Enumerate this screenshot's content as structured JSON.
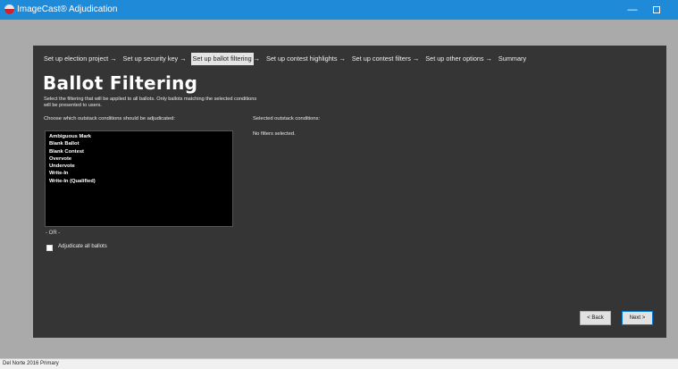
{
  "window": {
    "title": "ImageCast® Adjudication",
    "minimize_glyph": "—",
    "app_icon": "imagecast-logo-icon"
  },
  "wizard": {
    "steps": [
      {
        "label": "Set up election project",
        "active": false
      },
      {
        "label": "Set up security key",
        "active": false
      },
      {
        "label": "Set up ballot filtering",
        "active": true
      },
      {
        "label": "Set up contest highlights",
        "active": false
      },
      {
        "label": "Set up contest filters",
        "active": false
      },
      {
        "label": "Set up other options",
        "active": false
      },
      {
        "label": "Summary",
        "active": false
      }
    ],
    "arrow": "→"
  },
  "page": {
    "title": "Ballot Filtering",
    "description": "Select the filtering that will be applied to all ballots. Only ballots matching the selected conditions will be presented to users."
  },
  "conditions": {
    "label": "Choose which outstack conditions should be adjudicated:",
    "items": [
      "Ambiguous Mark",
      "Blank Ballot",
      "Blank Contest",
      "Overvote",
      "Undervote",
      "Write-In",
      "Write-In (Qualified)"
    ]
  },
  "selected": {
    "label": "Selected outstack conditions:",
    "empty_text": "No filters selected."
  },
  "alternative": {
    "or_text": "- OR -",
    "all_ballots_label": "Adjudicate all ballots",
    "all_ballots_checked": false
  },
  "buttons": {
    "back": "< Back",
    "next": "Next >"
  },
  "status": {
    "text": "Del Norte 2016 Primary"
  },
  "colors": {
    "titlebar": "#1f8ad8",
    "panel": "#353535",
    "list_bg": "#000000",
    "active_step": "#e4e4e4"
  }
}
